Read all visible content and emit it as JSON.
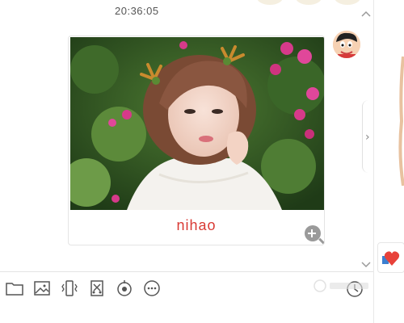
{
  "chat": {
    "timestamp": "20:36:05",
    "message": {
      "caption": "nihao",
      "caption_color": "#d93a34"
    }
  },
  "icons": {
    "scroll_up": "chevron-up-icon",
    "scroll_down": "chevron-down-icon",
    "side_toggle": "chevron-right-icon",
    "zoom": "zoom-in-icon",
    "avatar": "cartoon-avatar",
    "sticker": "heart-sticker-icon"
  },
  "side_toggle_glyph": "›",
  "toolbar": {
    "tools": [
      {
        "name": "folder-icon",
        "label": "file"
      },
      {
        "name": "image-icon",
        "label": "image"
      },
      {
        "name": "vibrate-icon",
        "label": "shake"
      },
      {
        "name": "scissors-icon",
        "label": "screenshot"
      },
      {
        "name": "record-icon",
        "label": "record"
      },
      {
        "name": "more-icon",
        "label": "more"
      }
    ],
    "history_icon": "clock-icon"
  },
  "colors": {
    "accent": "#d93a34",
    "border": "#e4e4e4",
    "icon": "#555555"
  }
}
